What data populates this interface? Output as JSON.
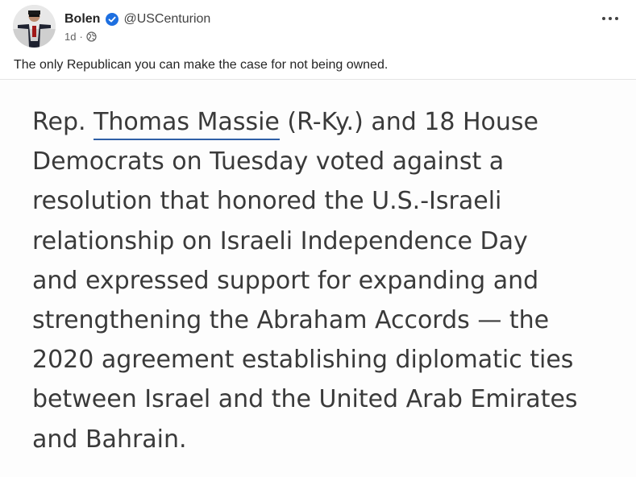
{
  "post": {
    "author_name": "Bolen",
    "handle": "@USCenturion",
    "timestamp": "1d",
    "meta_separator": "·",
    "verified": true,
    "visibility_icon": "globe-icon",
    "more_icon": "more-options-icon",
    "text": "The only Republican you can make the case for not being owned."
  },
  "image": {
    "lines": [
      {
        "before": "Rep. ",
        "link": "Thomas Massie",
        "after": " (R-Ky.) and 18 House"
      },
      {
        "text": "Democrats on Tuesday voted against a"
      },
      {
        "text": "resolution that honored the U.S.-Israeli"
      },
      {
        "text": "relationship on Israeli Independence Day"
      },
      {
        "text": "and expressed support for expanding and"
      },
      {
        "text": "strengthening the Abraham Accords — the"
      },
      {
        "text": "2020 agreement establishing diplomatic ties"
      },
      {
        "text": "between Israel and the United Arab Emirates"
      },
      {
        "text": "and Bahrain."
      }
    ]
  },
  "colors": {
    "verified_badge": "#1d6fe0",
    "link_underline": "#2f5fa6",
    "text": "#242424"
  }
}
